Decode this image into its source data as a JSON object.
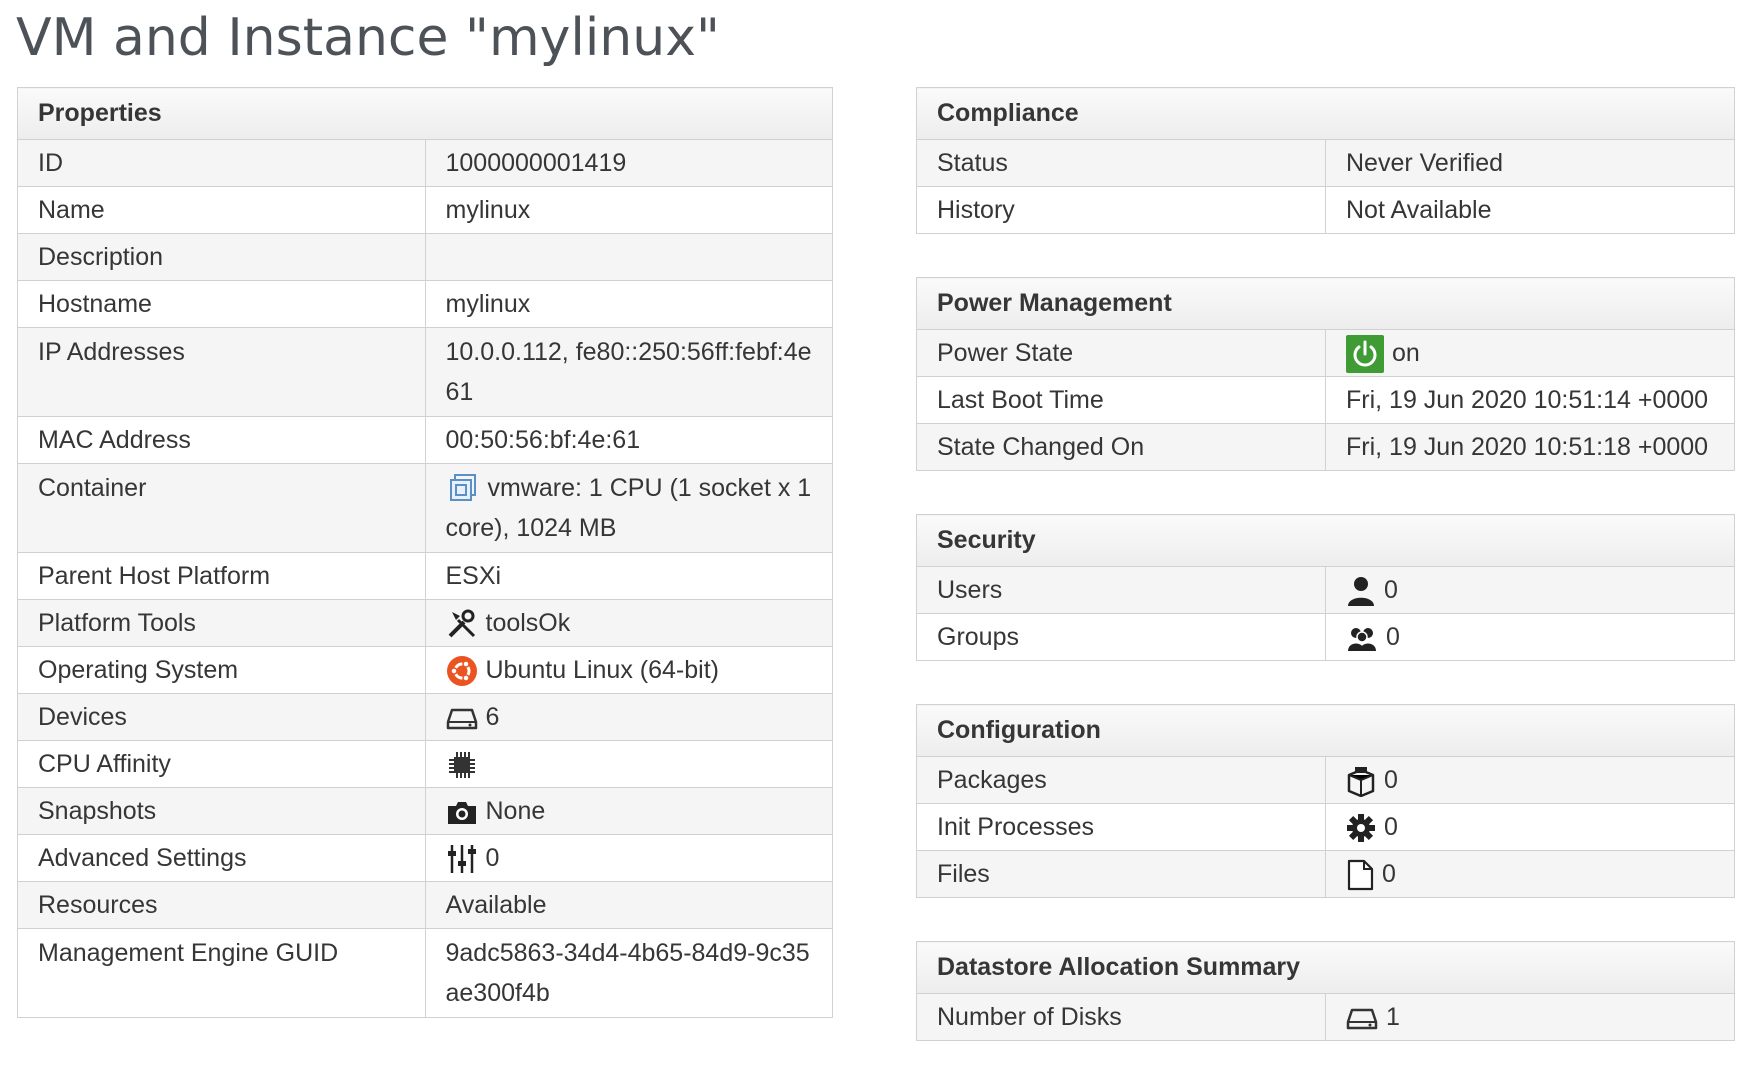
{
  "page_title": "VM and Instance \"mylinux\"",
  "properties": {
    "header": "Properties",
    "rows": [
      {
        "label": "ID",
        "value": "1000000001419"
      },
      {
        "label": "Name",
        "value": "mylinux"
      },
      {
        "label": "Description",
        "value": ""
      },
      {
        "label": "Hostname",
        "value": "mylinux"
      },
      {
        "label": "IP Addresses",
        "value": "10.0.0.112, fe80::250:56ff:febf:4e61"
      },
      {
        "label": "MAC Address",
        "value": "00:50:56:bf:4e:61"
      },
      {
        "label": "Container",
        "value": "vmware: 1 CPU (1 socket x 1 core), 1024 MB",
        "icon": "vmware-container-icon"
      },
      {
        "label": "Parent Host Platform",
        "value": "ESXi"
      },
      {
        "label": "Platform Tools",
        "value": "toolsOk",
        "icon": "tools-icon"
      },
      {
        "label": "Operating System",
        "value": "Ubuntu Linux (64-bit)",
        "icon": "ubuntu-icon"
      },
      {
        "label": "Devices",
        "value": "6",
        "icon": "hard-drive-icon"
      },
      {
        "label": "CPU Affinity",
        "value": "",
        "icon": "cpu-chip-icon"
      },
      {
        "label": "Snapshots",
        "value": "None",
        "icon": "camera-icon"
      },
      {
        "label": "Advanced Settings",
        "value": "0",
        "icon": "sliders-icon"
      },
      {
        "label": "Resources",
        "value": "Available"
      },
      {
        "label": "Management Engine GUID",
        "value": "9adc5863-34d4-4b65-84d9-9c35ae300f4b"
      }
    ]
  },
  "compliance": {
    "header": "Compliance",
    "rows": [
      {
        "label": "Status",
        "value": "Never Verified"
      },
      {
        "label": "History",
        "value": "Not Available"
      }
    ]
  },
  "power_management": {
    "header": "Power Management",
    "rows": [
      {
        "label": "Power State",
        "value": "on",
        "icon": "power-icon",
        "color": "#3f9c35"
      },
      {
        "label": "Last Boot Time",
        "value": "Fri, 19 Jun 2020 10:51:14 +0000"
      },
      {
        "label": "State Changed On",
        "value": "Fri, 19 Jun 2020 10:51:18 +0000"
      }
    ]
  },
  "security": {
    "header": "Security",
    "rows": [
      {
        "label": "Users",
        "value": "0",
        "icon": "user-icon"
      },
      {
        "label": "Groups",
        "value": "0",
        "icon": "group-icon"
      }
    ]
  },
  "configuration": {
    "header": "Configuration",
    "rows": [
      {
        "label": "Packages",
        "value": "0",
        "icon": "package-icon"
      },
      {
        "label": "Init Processes",
        "value": "0",
        "icon": "gear-icon"
      },
      {
        "label": "Files",
        "value": "0",
        "icon": "file-icon"
      }
    ]
  },
  "datastore": {
    "header": "Datastore Allocation Summary",
    "rows": [
      {
        "label": "Number of Disks",
        "value": "1",
        "icon": "hard-drive-icon"
      }
    ]
  }
}
